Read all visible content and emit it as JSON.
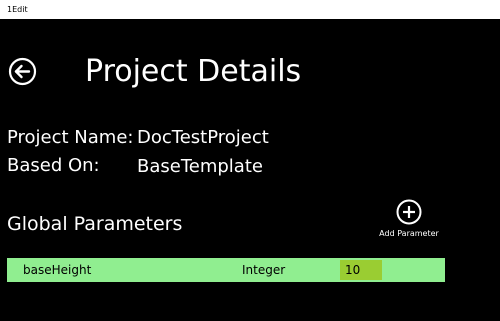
{
  "window": {
    "title": "1Edit"
  },
  "header": {
    "back_icon": "back-arrow-circle-icon",
    "title": "Project Details"
  },
  "project_info": {
    "name_label": "Project Name:",
    "name_value": "DocTestProject",
    "based_on_label": "Based On:",
    "based_on_value": "BaseTemplate"
  },
  "global_parameters": {
    "title": "Global Parameters",
    "add_button": {
      "icon": "plus-circle-icon",
      "label": "Add Parameter"
    },
    "rows": [
      {
        "name": "baseHeight",
        "type": "Integer",
        "value": "10"
      }
    ]
  },
  "colors": {
    "background": "#000000",
    "title_bar": "#ffffff",
    "text": "#ffffff",
    "row_background": "#90ee90",
    "value_background": "#9acd32"
  }
}
